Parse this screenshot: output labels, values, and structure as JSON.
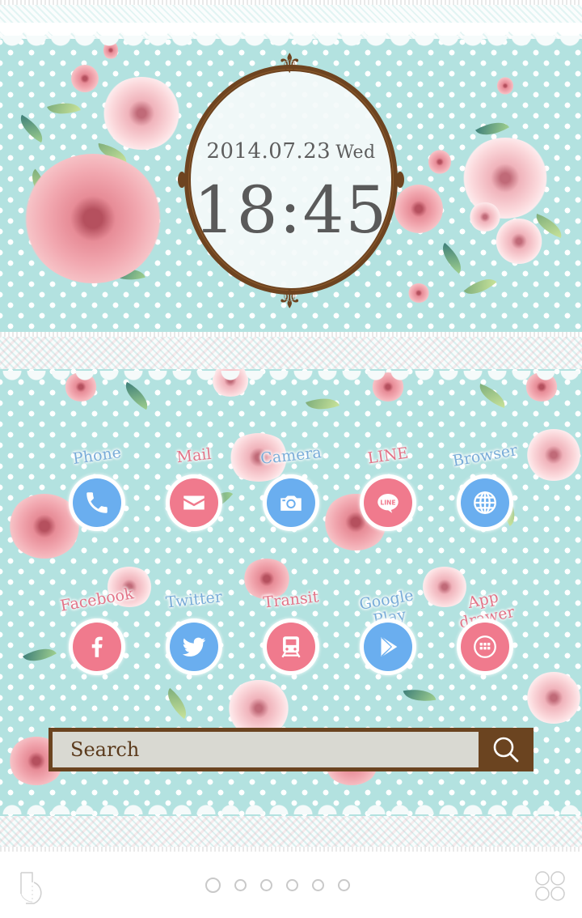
{
  "clock_widget": {
    "date": "2014.07.23",
    "weekday": "Wed",
    "time": "18:45"
  },
  "apps": [
    {
      "label": "Phone",
      "icon": "phone-icon",
      "color": "blue"
    },
    {
      "label": "Mail",
      "icon": "envelope-icon",
      "color": "pink"
    },
    {
      "label": "Camera",
      "icon": "camera-icon",
      "color": "blue"
    },
    {
      "label": "LINE",
      "icon": "line-icon",
      "icon_text": "LINE",
      "color": "pink"
    },
    {
      "label": "Browser",
      "icon": "globe-icon",
      "color": "blue"
    },
    {
      "label": "Facebook",
      "icon": "facebook-icon",
      "color": "pink"
    },
    {
      "label": "Twitter",
      "icon": "twitter-bird-icon",
      "color": "blue"
    },
    {
      "label": "Transit",
      "icon": "train-icon",
      "color": "pink"
    },
    {
      "label": "Google Play",
      "icon": "play-store-icon",
      "color": "blue"
    },
    {
      "label": "App drawer",
      "icon": "app-grid-icon",
      "color": "pink"
    }
  ],
  "search": {
    "placeholder": "Search",
    "button_icon": "search-icon"
  },
  "dock": {
    "left_icon": "theme-settings-icon",
    "right_icon": "all-apps-icon",
    "page_count": 6,
    "current_page": 1
  },
  "colors": {
    "background_mint": "#b3e2e0",
    "frame_brown": "#6e4420",
    "accent_blue": "#6aaeef",
    "accent_pink": "#f07a8d",
    "label_blue": "#79acd8",
    "label_pink": "#e27488",
    "clock_text": "#5a5a5a"
  }
}
